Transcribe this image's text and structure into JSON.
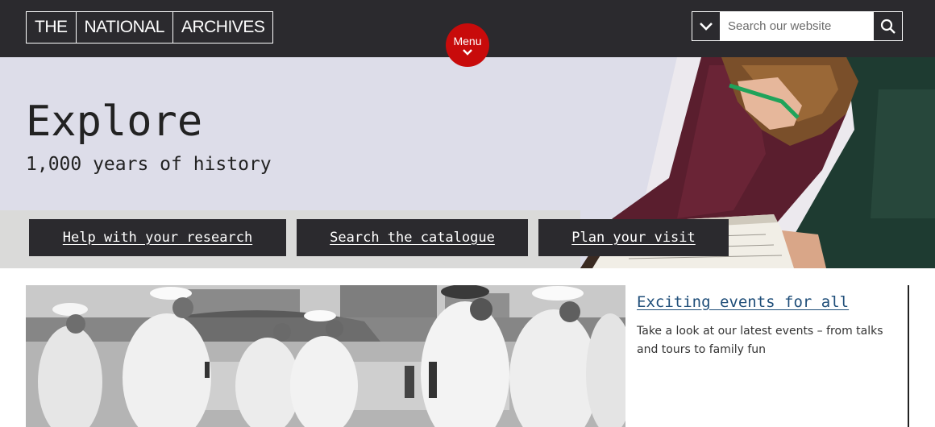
{
  "header": {
    "logo_words": [
      "THE",
      "NATIONAL",
      "ARCHIVES"
    ],
    "menu_label": "Menu",
    "search": {
      "placeholder": "Search our website"
    }
  },
  "hero": {
    "title": "Explore",
    "subtitle": "1,000 years of history",
    "buttons": [
      {
        "label": "Help with your research"
      },
      {
        "label": "Search the catalogue"
      },
      {
        "label": "Plan your visit"
      }
    ]
  },
  "feature": {
    "title": "Exciting events for all",
    "description": "Take a look at our latest events – from talks and tours to family fun"
  },
  "colors": {
    "header_bg": "#2b2a2e",
    "menu_red": "#c80b0b",
    "hero_bg": "#dddde9",
    "link_blue": "#1f4e79"
  }
}
